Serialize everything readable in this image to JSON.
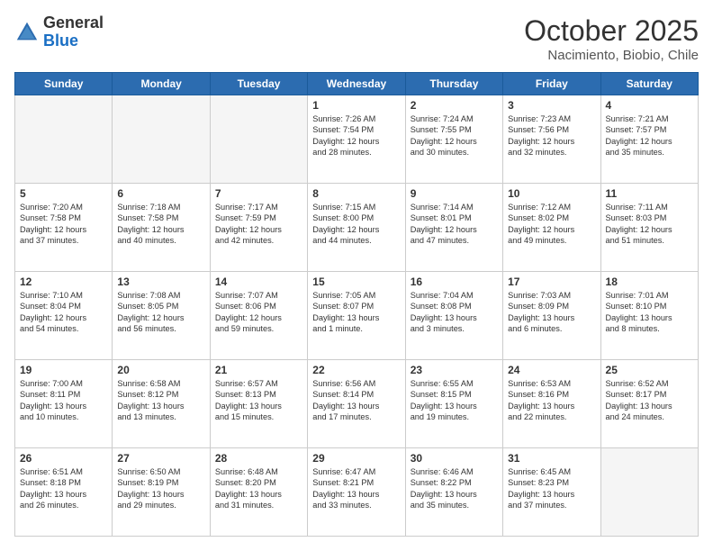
{
  "header": {
    "logo": {
      "general": "General",
      "blue": "Blue"
    },
    "title": "October 2025",
    "subtitle": "Nacimiento, Biobio, Chile"
  },
  "weekdays": [
    "Sunday",
    "Monday",
    "Tuesday",
    "Wednesday",
    "Thursday",
    "Friday",
    "Saturday"
  ],
  "weeks": [
    [
      {
        "day": "",
        "info": ""
      },
      {
        "day": "",
        "info": ""
      },
      {
        "day": "",
        "info": ""
      },
      {
        "day": "1",
        "info": "Sunrise: 7:26 AM\nSunset: 7:54 PM\nDaylight: 12 hours\nand 28 minutes."
      },
      {
        "day": "2",
        "info": "Sunrise: 7:24 AM\nSunset: 7:55 PM\nDaylight: 12 hours\nand 30 minutes."
      },
      {
        "day": "3",
        "info": "Sunrise: 7:23 AM\nSunset: 7:56 PM\nDaylight: 12 hours\nand 32 minutes."
      },
      {
        "day": "4",
        "info": "Sunrise: 7:21 AM\nSunset: 7:57 PM\nDaylight: 12 hours\nand 35 minutes."
      }
    ],
    [
      {
        "day": "5",
        "info": "Sunrise: 7:20 AM\nSunset: 7:58 PM\nDaylight: 12 hours\nand 37 minutes."
      },
      {
        "day": "6",
        "info": "Sunrise: 7:18 AM\nSunset: 7:58 PM\nDaylight: 12 hours\nand 40 minutes."
      },
      {
        "day": "7",
        "info": "Sunrise: 7:17 AM\nSunset: 7:59 PM\nDaylight: 12 hours\nand 42 minutes."
      },
      {
        "day": "8",
        "info": "Sunrise: 7:15 AM\nSunset: 8:00 PM\nDaylight: 12 hours\nand 44 minutes."
      },
      {
        "day": "9",
        "info": "Sunrise: 7:14 AM\nSunset: 8:01 PM\nDaylight: 12 hours\nand 47 minutes."
      },
      {
        "day": "10",
        "info": "Sunrise: 7:12 AM\nSunset: 8:02 PM\nDaylight: 12 hours\nand 49 minutes."
      },
      {
        "day": "11",
        "info": "Sunrise: 7:11 AM\nSunset: 8:03 PM\nDaylight: 12 hours\nand 51 minutes."
      }
    ],
    [
      {
        "day": "12",
        "info": "Sunrise: 7:10 AM\nSunset: 8:04 PM\nDaylight: 12 hours\nand 54 minutes."
      },
      {
        "day": "13",
        "info": "Sunrise: 7:08 AM\nSunset: 8:05 PM\nDaylight: 12 hours\nand 56 minutes."
      },
      {
        "day": "14",
        "info": "Sunrise: 7:07 AM\nSunset: 8:06 PM\nDaylight: 12 hours\nand 59 minutes."
      },
      {
        "day": "15",
        "info": "Sunrise: 7:05 AM\nSunset: 8:07 PM\nDaylight: 13 hours\nand 1 minute."
      },
      {
        "day": "16",
        "info": "Sunrise: 7:04 AM\nSunset: 8:08 PM\nDaylight: 13 hours\nand 3 minutes."
      },
      {
        "day": "17",
        "info": "Sunrise: 7:03 AM\nSunset: 8:09 PM\nDaylight: 13 hours\nand 6 minutes."
      },
      {
        "day": "18",
        "info": "Sunrise: 7:01 AM\nSunset: 8:10 PM\nDaylight: 13 hours\nand 8 minutes."
      }
    ],
    [
      {
        "day": "19",
        "info": "Sunrise: 7:00 AM\nSunset: 8:11 PM\nDaylight: 13 hours\nand 10 minutes."
      },
      {
        "day": "20",
        "info": "Sunrise: 6:58 AM\nSunset: 8:12 PM\nDaylight: 13 hours\nand 13 minutes."
      },
      {
        "day": "21",
        "info": "Sunrise: 6:57 AM\nSunset: 8:13 PM\nDaylight: 13 hours\nand 15 minutes."
      },
      {
        "day": "22",
        "info": "Sunrise: 6:56 AM\nSunset: 8:14 PM\nDaylight: 13 hours\nand 17 minutes."
      },
      {
        "day": "23",
        "info": "Sunrise: 6:55 AM\nSunset: 8:15 PM\nDaylight: 13 hours\nand 19 minutes."
      },
      {
        "day": "24",
        "info": "Sunrise: 6:53 AM\nSunset: 8:16 PM\nDaylight: 13 hours\nand 22 minutes."
      },
      {
        "day": "25",
        "info": "Sunrise: 6:52 AM\nSunset: 8:17 PM\nDaylight: 13 hours\nand 24 minutes."
      }
    ],
    [
      {
        "day": "26",
        "info": "Sunrise: 6:51 AM\nSunset: 8:18 PM\nDaylight: 13 hours\nand 26 minutes."
      },
      {
        "day": "27",
        "info": "Sunrise: 6:50 AM\nSunset: 8:19 PM\nDaylight: 13 hours\nand 29 minutes."
      },
      {
        "day": "28",
        "info": "Sunrise: 6:48 AM\nSunset: 8:20 PM\nDaylight: 13 hours\nand 31 minutes."
      },
      {
        "day": "29",
        "info": "Sunrise: 6:47 AM\nSunset: 8:21 PM\nDaylight: 13 hours\nand 33 minutes."
      },
      {
        "day": "30",
        "info": "Sunrise: 6:46 AM\nSunset: 8:22 PM\nDaylight: 13 hours\nand 35 minutes."
      },
      {
        "day": "31",
        "info": "Sunrise: 6:45 AM\nSunset: 8:23 PM\nDaylight: 13 hours\nand 37 minutes."
      },
      {
        "day": "",
        "info": ""
      }
    ]
  ]
}
